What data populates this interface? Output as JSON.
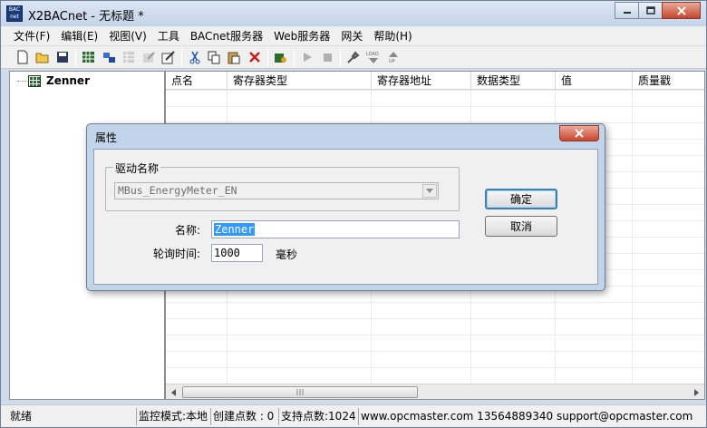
{
  "window": {
    "title": "X2BACnet - 无标题 *",
    "app_icon_text": "BAC net"
  },
  "menu": [
    "文件(F)",
    "编辑(E)",
    "视图(V)",
    "工具",
    "BACnet服务器",
    "Web服务器",
    "网关",
    "帮助(H)"
  ],
  "tree": {
    "root_label": "Zenner"
  },
  "columns": [
    "点名",
    "寄存器类型",
    "寄存器地址",
    "数据类型",
    "值",
    "质量戳"
  ],
  "dialog": {
    "title": "属性",
    "group_label": "驱动名称",
    "driver_value": "MBus_EnergyMeter_EN",
    "name_label": "名称:",
    "name_value": "Zenner",
    "poll_label": "轮询时间:",
    "poll_value": "1000",
    "poll_unit": "毫秒",
    "ok_label": "确定",
    "cancel_label": "取消"
  },
  "status": {
    "ready": "就绪",
    "monitor_mode": "监控模式:本地",
    "created_points": "创建点数 : 0",
    "supported_points": "支持点数:1024",
    "contact": "www.opcmaster.com 13564889340 support@opcmaster.com"
  }
}
